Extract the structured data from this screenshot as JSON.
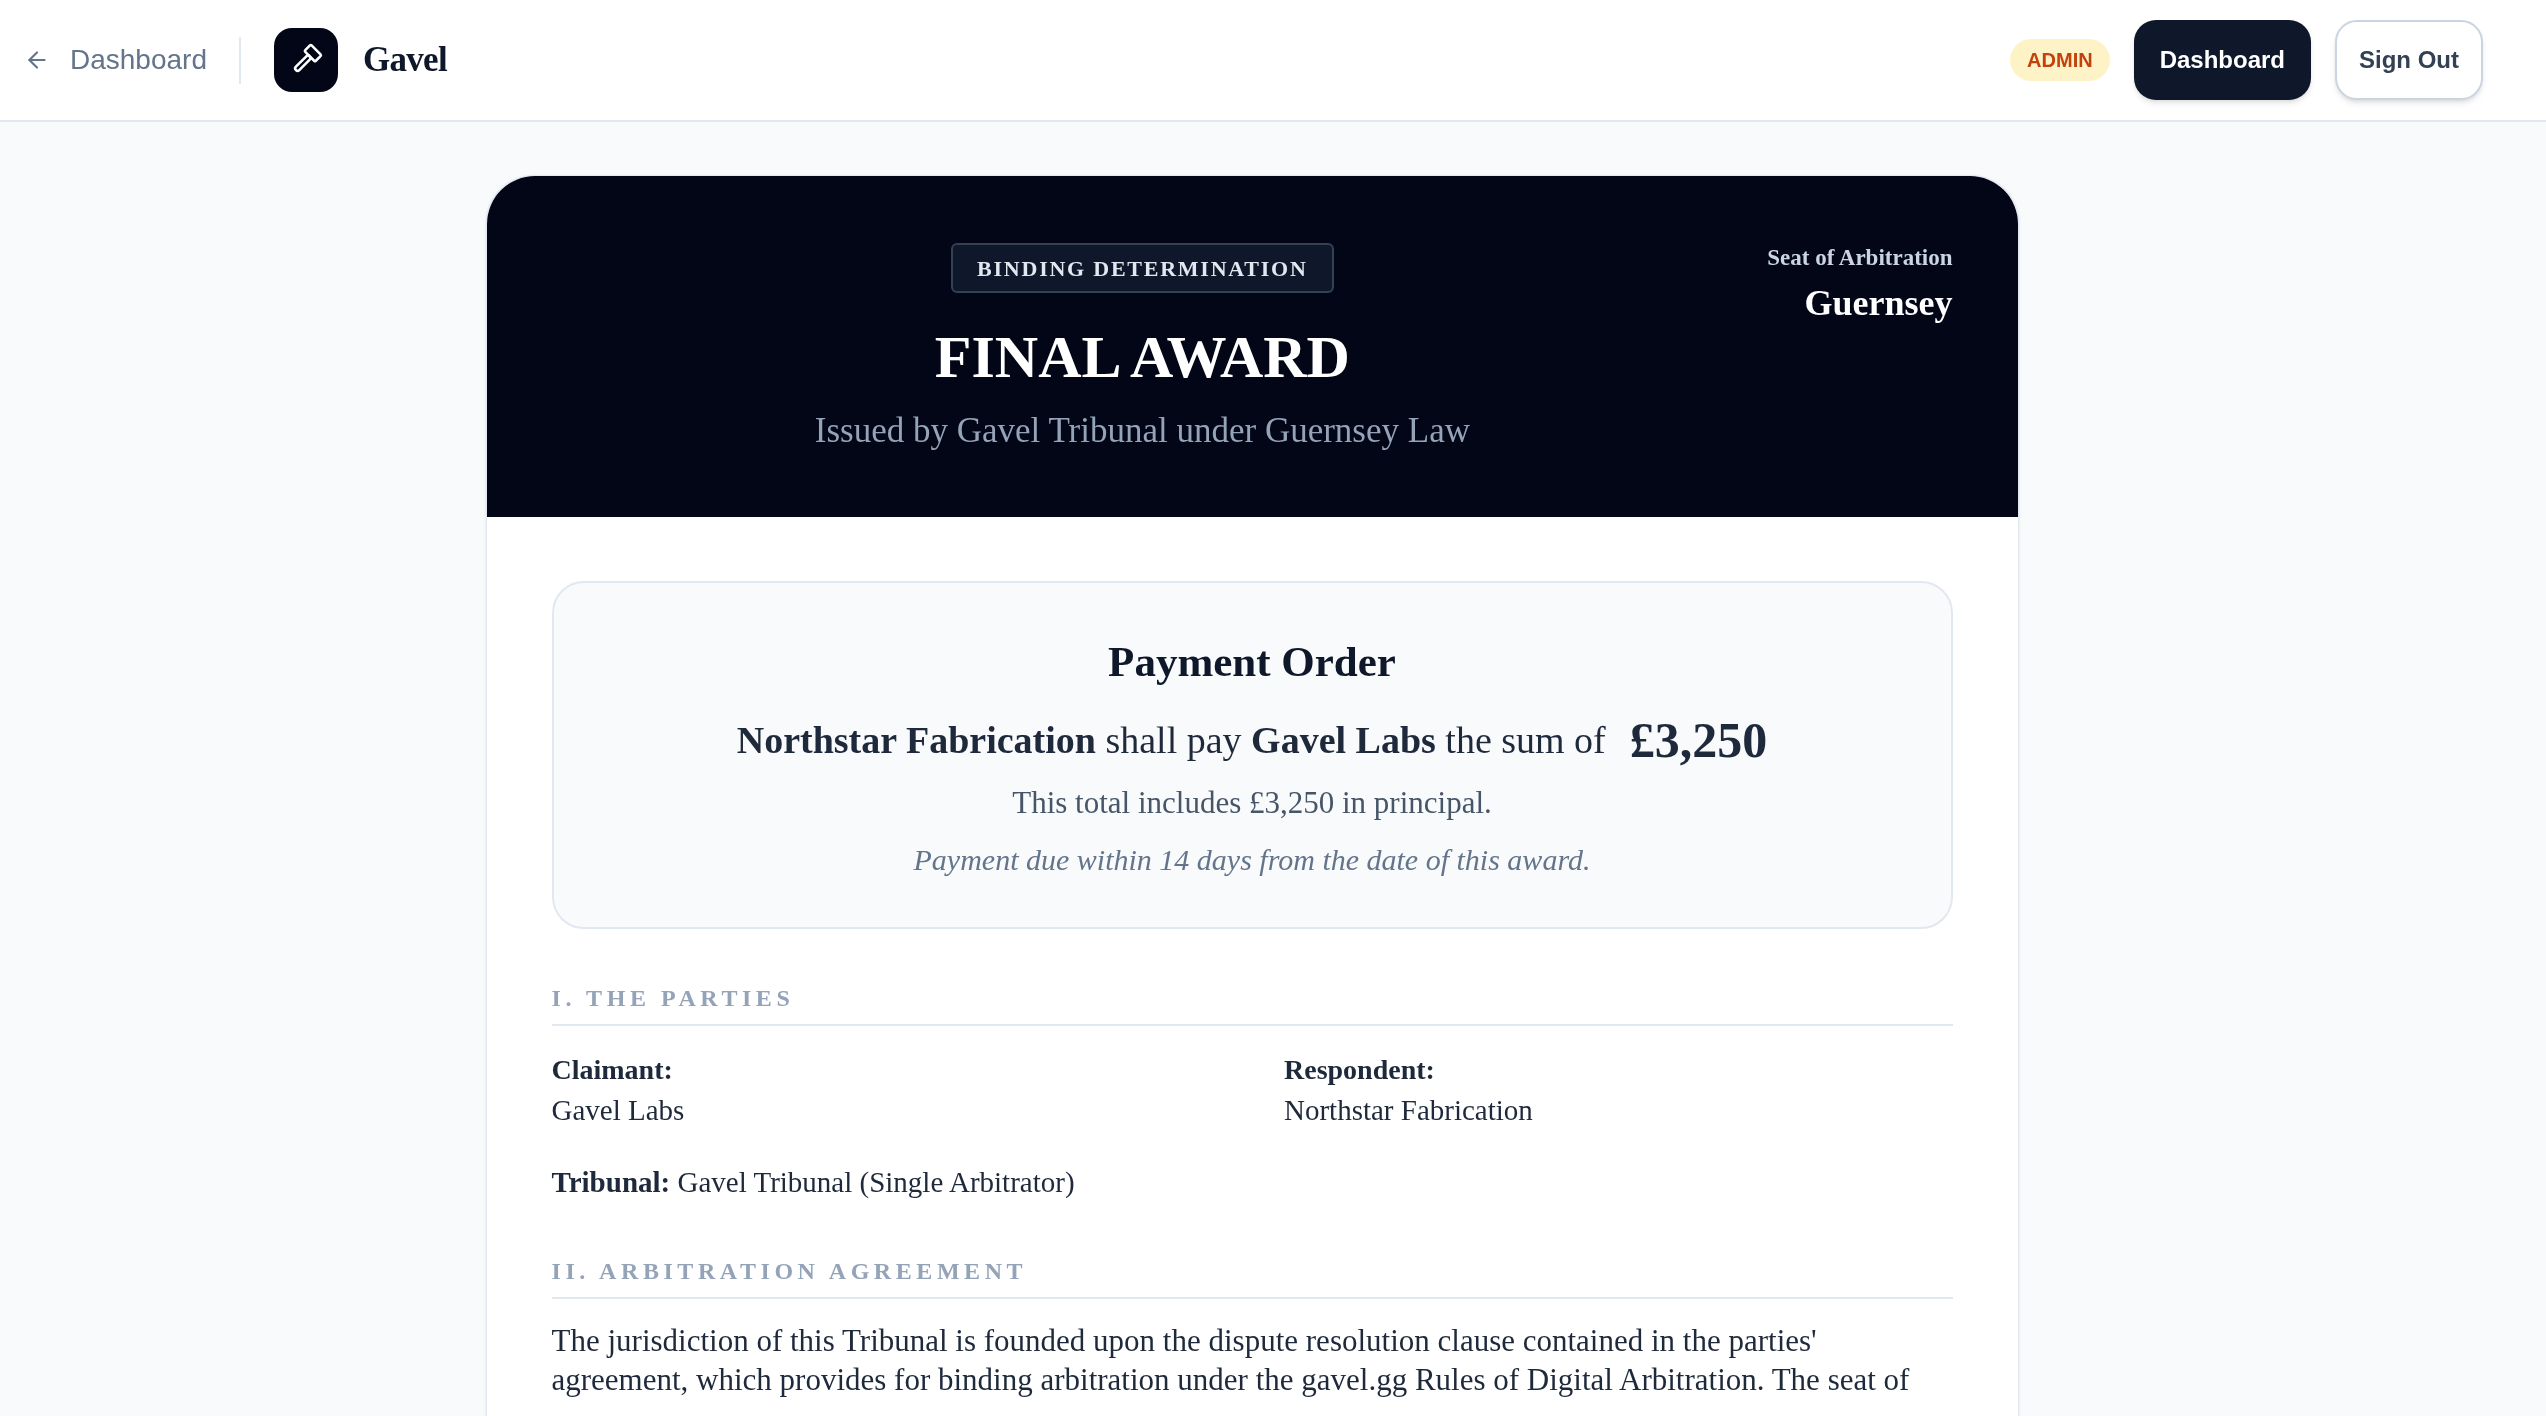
{
  "nav": {
    "back_link": "Dashboard",
    "brand": "Gavel",
    "role_badge": "ADMIN",
    "buttons": [
      {
        "label": "Dashboard",
        "kind": "primary"
      },
      {
        "label": "Sign Out",
        "kind": "outline"
      }
    ]
  },
  "award_header": {
    "badge": "BINDING DETERMINATION",
    "title": "FINAL AWARD",
    "subtitle": "Issued by Gavel Tribunal under Guernsey Law",
    "seat_label": "Seat of Arbitration",
    "seat": "Guernsey"
  },
  "payment_order": {
    "title": "Payment Order",
    "statement": "**Northstar Fabrication** shall pay **Gavel Labs** the sum of",
    "amount": "£3,250",
    "breakdown": "This total includes £3,250 in principal.",
    "due_note": "Payment due within 14 days from the date of this award."
  },
  "sections": [
    {
      "kind": "parties",
      "heading": "I. THE PARTIES",
      "claimant_label": "Claimant:",
      "claimant": "Gavel Labs",
      "respondent_label": "Respondent:",
      "respondent": "Northstar Fabrication",
      "tribunal": "**Tribunal:** Gavel Tribunal (Single Arbitrator)"
    },
    {
      "kind": "text",
      "heading": "II. ARBITRATION AGREEMENT",
      "lines": [
        "The jurisdiction of this Tribunal is founded upon the dispute resolution clause contained in the parties'",
        "agreement, which provides for binding arbitration under the gavel.gg Rules of Digital Arbitration. The seat of"
      ]
    }
  ]
}
